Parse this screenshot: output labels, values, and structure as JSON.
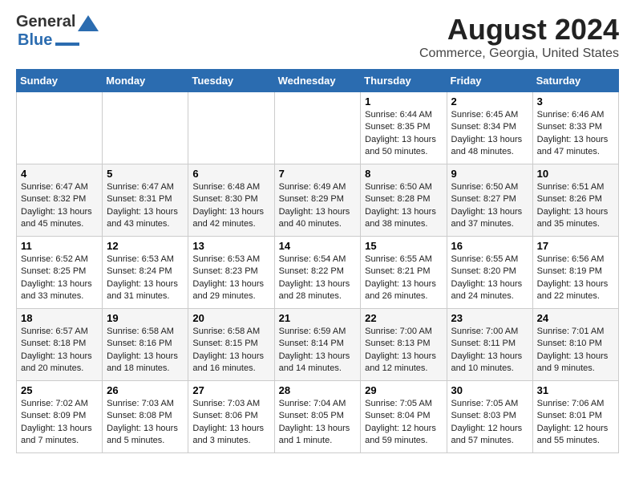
{
  "header": {
    "logo_line1": "General",
    "logo_line2": "Blue",
    "title": "August 2024",
    "subtitle": "Commerce, Georgia, United States"
  },
  "calendar": {
    "days_of_week": [
      "Sunday",
      "Monday",
      "Tuesday",
      "Wednesday",
      "Thursday",
      "Friday",
      "Saturday"
    ],
    "weeks": [
      [
        {
          "day": "",
          "info": ""
        },
        {
          "day": "",
          "info": ""
        },
        {
          "day": "",
          "info": ""
        },
        {
          "day": "",
          "info": ""
        },
        {
          "day": "1",
          "info": "Sunrise: 6:44 AM\nSunset: 8:35 PM\nDaylight: 13 hours\nand 50 minutes."
        },
        {
          "day": "2",
          "info": "Sunrise: 6:45 AM\nSunset: 8:34 PM\nDaylight: 13 hours\nand 48 minutes."
        },
        {
          "day": "3",
          "info": "Sunrise: 6:46 AM\nSunset: 8:33 PM\nDaylight: 13 hours\nand 47 minutes."
        }
      ],
      [
        {
          "day": "4",
          "info": "Sunrise: 6:47 AM\nSunset: 8:32 PM\nDaylight: 13 hours\nand 45 minutes."
        },
        {
          "day": "5",
          "info": "Sunrise: 6:47 AM\nSunset: 8:31 PM\nDaylight: 13 hours\nand 43 minutes."
        },
        {
          "day": "6",
          "info": "Sunrise: 6:48 AM\nSunset: 8:30 PM\nDaylight: 13 hours\nand 42 minutes."
        },
        {
          "day": "7",
          "info": "Sunrise: 6:49 AM\nSunset: 8:29 PM\nDaylight: 13 hours\nand 40 minutes."
        },
        {
          "day": "8",
          "info": "Sunrise: 6:50 AM\nSunset: 8:28 PM\nDaylight: 13 hours\nand 38 minutes."
        },
        {
          "day": "9",
          "info": "Sunrise: 6:50 AM\nSunset: 8:27 PM\nDaylight: 13 hours\nand 37 minutes."
        },
        {
          "day": "10",
          "info": "Sunrise: 6:51 AM\nSunset: 8:26 PM\nDaylight: 13 hours\nand 35 minutes."
        }
      ],
      [
        {
          "day": "11",
          "info": "Sunrise: 6:52 AM\nSunset: 8:25 PM\nDaylight: 13 hours\nand 33 minutes."
        },
        {
          "day": "12",
          "info": "Sunrise: 6:53 AM\nSunset: 8:24 PM\nDaylight: 13 hours\nand 31 minutes."
        },
        {
          "day": "13",
          "info": "Sunrise: 6:53 AM\nSunset: 8:23 PM\nDaylight: 13 hours\nand 29 minutes."
        },
        {
          "day": "14",
          "info": "Sunrise: 6:54 AM\nSunset: 8:22 PM\nDaylight: 13 hours\nand 28 minutes."
        },
        {
          "day": "15",
          "info": "Sunrise: 6:55 AM\nSunset: 8:21 PM\nDaylight: 13 hours\nand 26 minutes."
        },
        {
          "day": "16",
          "info": "Sunrise: 6:55 AM\nSunset: 8:20 PM\nDaylight: 13 hours\nand 24 minutes."
        },
        {
          "day": "17",
          "info": "Sunrise: 6:56 AM\nSunset: 8:19 PM\nDaylight: 13 hours\nand 22 minutes."
        }
      ],
      [
        {
          "day": "18",
          "info": "Sunrise: 6:57 AM\nSunset: 8:18 PM\nDaylight: 13 hours\nand 20 minutes."
        },
        {
          "day": "19",
          "info": "Sunrise: 6:58 AM\nSunset: 8:16 PM\nDaylight: 13 hours\nand 18 minutes."
        },
        {
          "day": "20",
          "info": "Sunrise: 6:58 AM\nSunset: 8:15 PM\nDaylight: 13 hours\nand 16 minutes."
        },
        {
          "day": "21",
          "info": "Sunrise: 6:59 AM\nSunset: 8:14 PM\nDaylight: 13 hours\nand 14 minutes."
        },
        {
          "day": "22",
          "info": "Sunrise: 7:00 AM\nSunset: 8:13 PM\nDaylight: 13 hours\nand 12 minutes."
        },
        {
          "day": "23",
          "info": "Sunrise: 7:00 AM\nSunset: 8:11 PM\nDaylight: 13 hours\nand 10 minutes."
        },
        {
          "day": "24",
          "info": "Sunrise: 7:01 AM\nSunset: 8:10 PM\nDaylight: 13 hours\nand 9 minutes."
        }
      ],
      [
        {
          "day": "25",
          "info": "Sunrise: 7:02 AM\nSunset: 8:09 PM\nDaylight: 13 hours\nand 7 minutes."
        },
        {
          "day": "26",
          "info": "Sunrise: 7:03 AM\nSunset: 8:08 PM\nDaylight: 13 hours\nand 5 minutes."
        },
        {
          "day": "27",
          "info": "Sunrise: 7:03 AM\nSunset: 8:06 PM\nDaylight: 13 hours\nand 3 minutes."
        },
        {
          "day": "28",
          "info": "Sunrise: 7:04 AM\nSunset: 8:05 PM\nDaylight: 13 hours\nand 1 minute."
        },
        {
          "day": "29",
          "info": "Sunrise: 7:05 AM\nSunset: 8:04 PM\nDaylight: 12 hours\nand 59 minutes."
        },
        {
          "day": "30",
          "info": "Sunrise: 7:05 AM\nSunset: 8:03 PM\nDaylight: 12 hours\nand 57 minutes."
        },
        {
          "day": "31",
          "info": "Sunrise: 7:06 AM\nSunset: 8:01 PM\nDaylight: 12 hours\nand 55 minutes."
        }
      ]
    ]
  }
}
